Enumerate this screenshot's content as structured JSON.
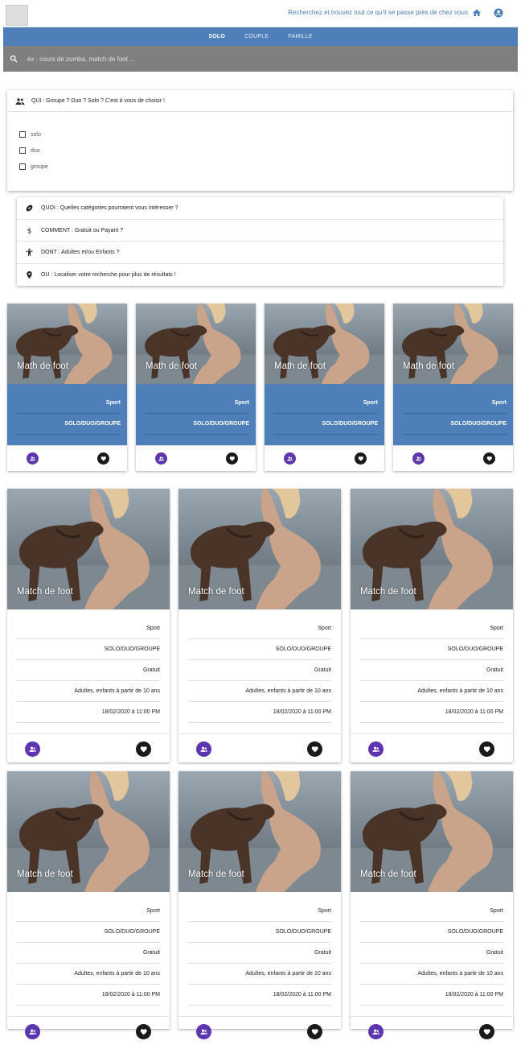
{
  "header": {
    "tagline": "Recherchez et trouvez tout ce qu'il se passe près de chez vous",
    "icons": [
      "home-icon",
      "account-icon"
    ]
  },
  "nav": {
    "tabs": [
      "SOLO",
      "COUPLE",
      "FAMILLE"
    ],
    "active": "SOLO"
  },
  "search": {
    "placeholder": "ex : cours de zumba, match de foot ..."
  },
  "qui": {
    "title": "QUI : Groupe ? Duo ? Solo ? C'est à vous de choisir !",
    "options": [
      "solo",
      "duo",
      "groupe"
    ]
  },
  "accordion": [
    {
      "icon": "football-icon",
      "label": "QUOI : Quelles catégories pourraient vous intéresser ?"
    },
    {
      "icon": "dollar-icon",
      "label": "COMMENT : Gratuit ou Payant ?"
    },
    {
      "icon": "child-icon",
      "label": "DONT : Adultes et/ou Enfants ?"
    },
    {
      "icon": "location-pin-icon",
      "label": "OU : Localiser votre recherche pour plus de résultats !"
    }
  ],
  "small_cards": [
    {
      "title": "Math de foot",
      "category": "Sport",
      "type": "SOLO/DUO/GROUPE"
    },
    {
      "title": "Math de foot",
      "category": "Sport",
      "type": "SOLO/DUO/GROUPE"
    },
    {
      "title": "Math de foot",
      "category": "Sport",
      "type": "SOLO/DUO/GROUPE"
    },
    {
      "title": "Math de foot",
      "category": "Sport",
      "type": "SOLO/DUO/GROUPE"
    }
  ],
  "big_cards": [
    {
      "title": "Match de foot",
      "category": "Sport",
      "type": "SOLO/DUO/GROUPE",
      "price": "Gratuit",
      "audience": "Adultes, enfants à partir de 10 ans",
      "date": "18/02/2020 à 11:00 PM"
    },
    {
      "title": "Match de foot",
      "category": "Sport",
      "type": "SOLO/DUO/GROUPE",
      "price": "Gratuit",
      "audience": "Adultes, enfants à partir de 10 ans",
      "date": "18/02/2020 à 11:00 PM"
    },
    {
      "title": "Match de foot",
      "category": "Sport",
      "type": "SOLO/DUO/GROUPE",
      "price": "Gratuit",
      "audience": "Adultes, enfants à partir de 10 ans",
      "date": "18/02/2020 à 11:00 PM"
    },
    {
      "title": "Match de foot",
      "category": "Sport",
      "type": "SOLO/DUO/GROUPE",
      "price": "Gratuit",
      "audience": "Adultes, enfants à partir de 10 ans",
      "date": "18/02/2020 à 11:00 PM"
    },
    {
      "title": "Match de foot",
      "category": "Sport",
      "type": "SOLO/DUO/GROUPE",
      "price": "Gratuit",
      "audience": "Adultes, enfants à partir de 10 ans",
      "date": "18/02/2020 à 11:00 PM"
    },
    {
      "title": "Match de foot",
      "category": "Sport",
      "type": "SOLO/DUO/GROUPE",
      "price": "Gratuit",
      "audience": "Adultes, enfants à partir de 10 ans",
      "date": "18/02/2020 à 11:00 PM"
    }
  ],
  "colors": {
    "brand_blue": "#4f7fb8",
    "group_button": "#5e35b1",
    "favorite_button": "#1a1a1a",
    "search_bar": "#7f7f7f"
  }
}
